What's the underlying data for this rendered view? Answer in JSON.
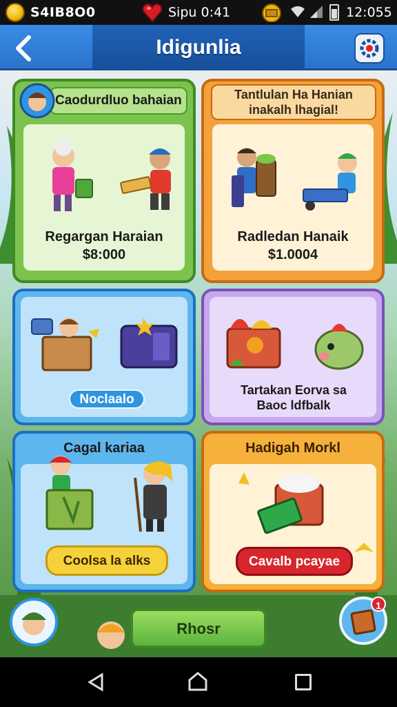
{
  "status_bar": {
    "coins": "S4IB8O0",
    "signal_text": "Sipu 0:41",
    "time": "12:055"
  },
  "header": {
    "title": "Idigunlia"
  },
  "cards": [
    {
      "banner": "Caodurdluo bahaian",
      "title": "Regargan Haraian",
      "value": "$8:000"
    },
    {
      "banner": "Tantlulan Ha Hanian inakalh lhagial!",
      "title": "Radledan Hanaik",
      "value": "$1.0004"
    },
    {
      "pill": "Noclaalo"
    },
    {
      "title": "Tartakan Eorva sa Baoc ldfbalk"
    },
    {
      "banner": "Cagal kariaa",
      "button": "Coolsa la alks"
    },
    {
      "banner": "Hadigah Morkl",
      "button": "Cavalb pcayae"
    }
  ],
  "bottom": {
    "main_button": "Rhosr",
    "notification_count": "1"
  },
  "colors": {
    "header_blue": "#2b72cc",
    "green_card": "#5cb33e",
    "orange_card": "#f08a1a",
    "blue_card": "#2f95e0",
    "purple_card": "#a47fd8",
    "yellow_button": "#f6d23a",
    "red_button": "#d8262c",
    "green_button": "#7bc84a"
  }
}
